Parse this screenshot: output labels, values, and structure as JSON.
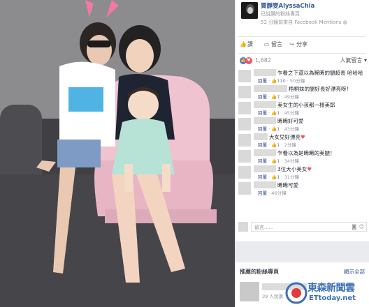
{
  "page": {
    "name": "賈靜雯AlyssaChia",
    "liked_label": "已說讚的粉絲專頁",
    "meta": "52 分鐘前來自 Facebook Mentions",
    "meta_icon": "globe-icon"
  },
  "actions": {
    "like": "讚",
    "comment": "留言",
    "share": "分享"
  },
  "reactions": {
    "count": "1,682",
    "sort": "人氣留言"
  },
  "comments": [
    {
      "text": "乍看之下還以為晞晞的腿超長 哈哈哈",
      "reply": "回覆",
      "likes": "110",
      "time": "50分鐘"
    },
    {
      "text": "梧桐妹的腿好長好漂亮呀！",
      "reply": "回覆",
      "likes": "7",
      "time": "49分鐘"
    },
    {
      "text": "美女生的小孩都一樣美耶",
      "reply": "回覆",
      "likes": "1",
      "time": "45分鐘"
    },
    {
      "text": "晞晞好可愛",
      "reply": "回覆",
      "likes": "1",
      "time": "43分鐘"
    },
    {
      "text": "大女兒好漂亮",
      "reply": "回覆",
      "likes": "1",
      "time": "2分鐘"
    },
    {
      "text": "乍看以為是晞晞的美腿！",
      "reply": "回覆",
      "likes": "1",
      "time": "34分鐘"
    },
    {
      "text": "3位大小美女",
      "reply": "回覆",
      "likes": "1",
      "time": "31分鐘"
    },
    {
      "text": "晞晞可愛",
      "reply": "回覆",
      "likes": "",
      "time": "46分鐘"
    }
  ],
  "comment_box": {
    "placeholder": "留言......"
  },
  "recommend": {
    "title": "推薦的粉絲專頁",
    "see_all": "顯示全部",
    "count": "39 人說讚"
  },
  "watermark": {
    "cn": "東森新聞雲",
    "en": "ETtoday.net"
  },
  "colors": {
    "link": "#365899",
    "watermark": "#3d6fb4",
    "like_blue": "#4b79d9"
  }
}
